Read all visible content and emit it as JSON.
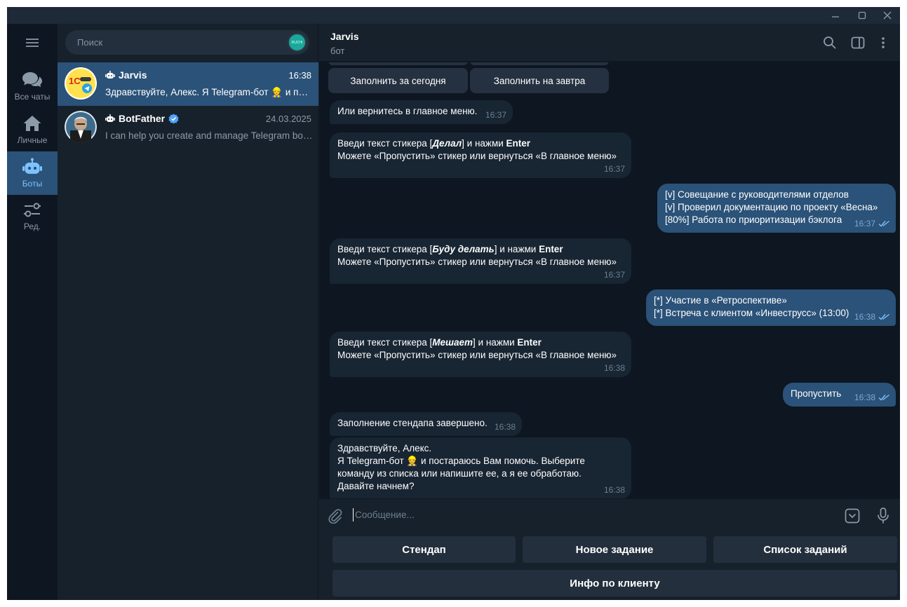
{
  "window": {
    "controls": [
      "minimize-icon",
      "maximize-icon",
      "close-icon"
    ]
  },
  "rail": {
    "menu_icon": "hamburger-icon",
    "folders": [
      {
        "label": "Все чаты",
        "icon": "chats-icon",
        "active": false
      },
      {
        "label": "Личные",
        "icon": "home-icon",
        "active": false
      },
      {
        "label": "Боты",
        "icon": "bot-icon",
        "active": true
      },
      {
        "label": "Ред.",
        "icon": "sliders-icon",
        "active": false
      }
    ]
  },
  "chatlist": {
    "search_placeholder": "Поиск",
    "search_badge": "RUCHI",
    "chats": [
      {
        "name": "Jarvis",
        "time": "16:38",
        "preview": "Здравствуйте, Алекс. Я Telegram-бот 👷 и постараюсь Вам помочь",
        "active": true,
        "verified": false
      },
      {
        "name": "BotFather",
        "time": "24.03.2025",
        "preview": "I can help you create and manage Telegram bots. If you're new to the Bot API",
        "active": false,
        "verified": true
      }
    ]
  },
  "header": {
    "title": "Jarvis",
    "status": "бот",
    "icons": [
      "search-icon",
      "sidebar-toggle-icon",
      "more-vertical-icon"
    ]
  },
  "inline_keyboard": {
    "buttons": [
      "Заполнить за сегодня",
      "Заполнить на завтра"
    ]
  },
  "messages": [
    {
      "dir": "in",
      "lines": [
        "Или вернитесь в главное меню."
      ],
      "time": "16:37"
    },
    {
      "dir": "in",
      "prefix": "Введи текст стикера [",
      "emph": "Делал",
      "suffix": "] и нажми ",
      "key": "Enter",
      "line2": "Можете «Пропустить» стикер или вернуться «В главное меню»",
      "time": "16:37"
    },
    {
      "dir": "out",
      "lines": [
        "[v] Совещание с руководителями отделов",
        "[v] Проверил документацию по проекту «Весна»",
        "[80%] Работа по приоритизации бэклога"
      ],
      "time": "16:37"
    },
    {
      "dir": "in",
      "prefix": "Введи текст стикера [",
      "emph": "Буду делать",
      "suffix": "] и нажми ",
      "key": "Enter",
      "line2": "Можете «Пропустить» стикер или вернуться «В главное меню»",
      "time": "16:37"
    },
    {
      "dir": "out",
      "lines": [
        "[*] Участие в «Ретроспективе»",
        "[*] Встреча с клиентом «Инвеструсс» (13:00)"
      ],
      "time": "16:38"
    },
    {
      "dir": "in",
      "prefix": "Введи текст стикера [",
      "emph": "Мешает",
      "suffix": "] и нажми ",
      "key": "Enter",
      "line2": "Можете «Пропустить» стикер или вернуться «В главное меню»",
      "time": "16:38"
    },
    {
      "dir": "out",
      "lines": [
        "Пропустить"
      ],
      "time": "16:38"
    },
    {
      "dir": "in",
      "lines": [
        "Заполнение стендапа завершено."
      ],
      "time": "16:38"
    },
    {
      "dir": "in",
      "lines": [
        "Здравствуйте, Алекс.",
        "Я Telegram-бот 👷 и постараюсь Вам помочь. Выберите",
        "команду из списка или напишите ее, а я ее обработаю.",
        "Давайте начнем?"
      ],
      "time": "16:38"
    }
  ],
  "composer": {
    "placeholder": "Сообщение...",
    "icons": [
      "attach-icon",
      "keyboard-toggle-icon",
      "microphone-icon"
    ]
  },
  "bot_keyboard": {
    "row1": [
      "Стендап",
      "Новое задание",
      "Список заданий"
    ],
    "row2": [
      "Инфо по клиенту"
    ]
  },
  "colors": {
    "background": "#0e1621",
    "sidebar": "#17212b",
    "active": "#2b5278",
    "incoming": "#182533",
    "outgoing": "#2b5278",
    "accent": "#7dc2ff"
  }
}
